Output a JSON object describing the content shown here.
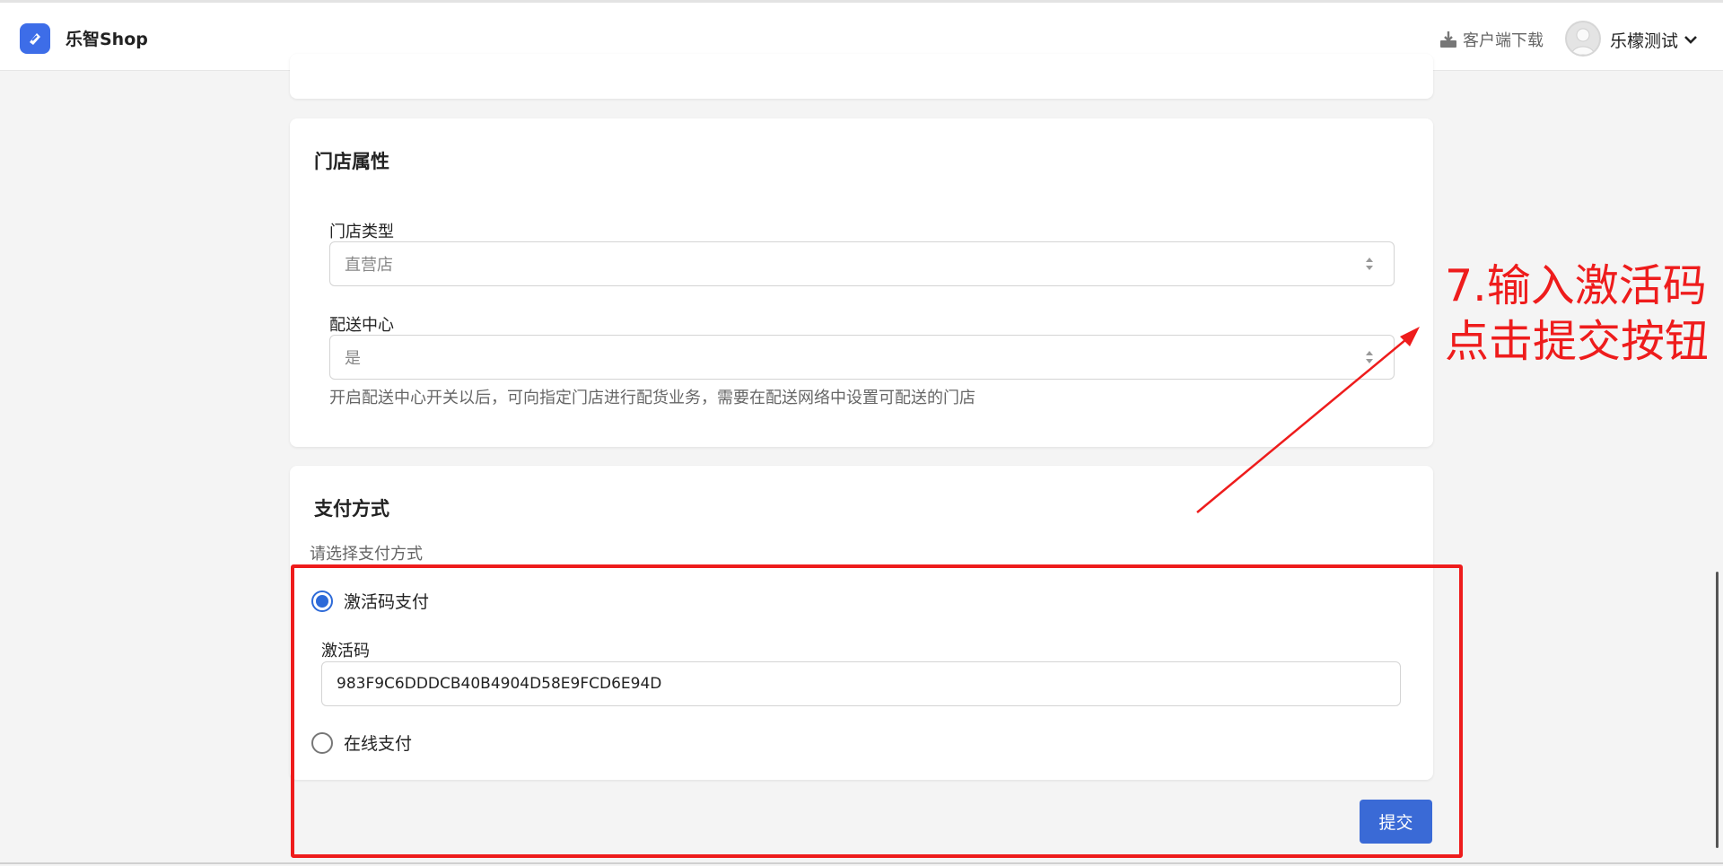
{
  "header": {
    "brand": "乐智Shop",
    "download_label": "客户端下载",
    "user_name": "乐檬测试"
  },
  "store_attributes": {
    "title": "门店属性",
    "store_type_label": "门店类型",
    "store_type_value": "直营店",
    "distribution_center_label": "配送中心",
    "distribution_center_value": "是",
    "distribution_hint": "开启配送中心开关以后，可向指定门店进行配货业务，需要在配送网络中设置可配送的门店"
  },
  "payment": {
    "title": "支付方式",
    "subtitle": "请选择支付方式",
    "options": [
      {
        "label": "激活码支付",
        "selected": true
      },
      {
        "label": "在线支付",
        "selected": false
      }
    ],
    "activation_code_label": "激活码",
    "activation_code_value": "983F9C6DDDCB40B4904D58E9FCD6E94D"
  },
  "submit_label": "提交",
  "annotation": {
    "line1": "7.输入激活码",
    "line2": "点击提交按钮",
    "color": "#ee1c1c"
  },
  "icons": [
    "app-logo-icon",
    "download-icon",
    "chevron-down-icon",
    "select-arrows-icon"
  ]
}
